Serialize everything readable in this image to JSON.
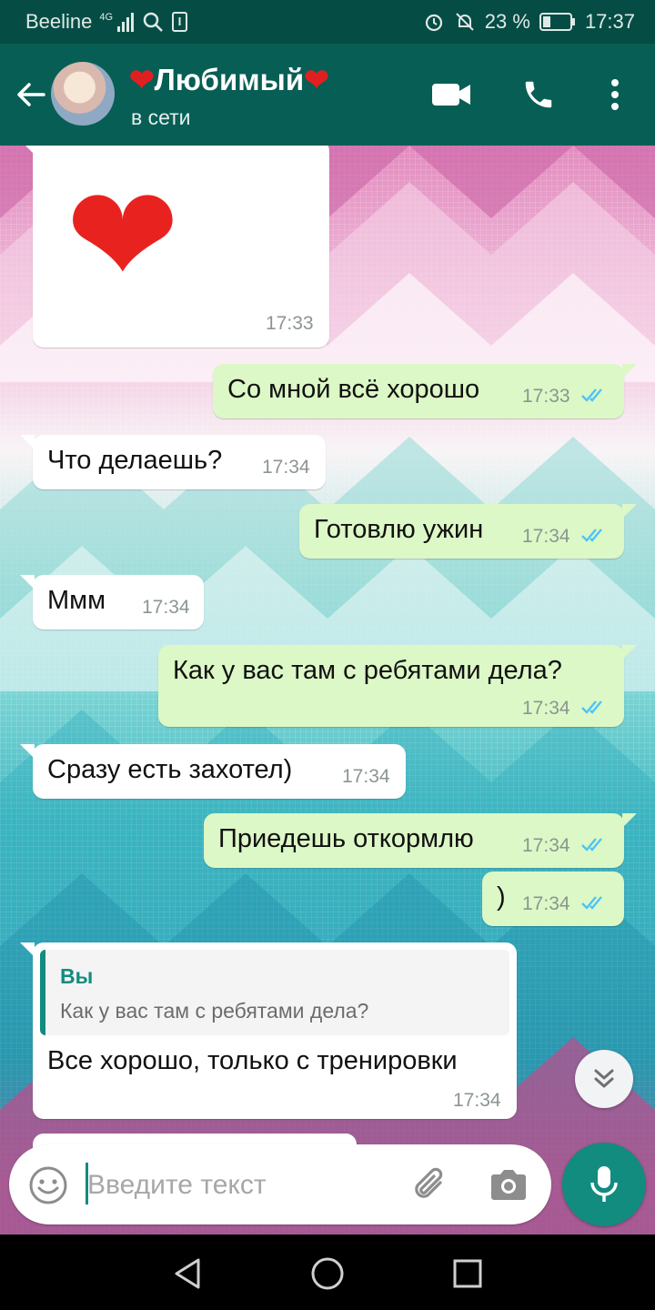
{
  "status_bar": {
    "carrier": "Beeline",
    "network": "4G",
    "battery": "23 %",
    "time": "17:37"
  },
  "header": {
    "contact_name": "Любимый",
    "contact_status": "в сети"
  },
  "messages": [
    {
      "direction": "in",
      "text": "❤",
      "time": "17:33",
      "type": "emoji"
    },
    {
      "direction": "out",
      "text": "Со мной всё хорошо",
      "time": "17:33",
      "status": "read"
    },
    {
      "direction": "in",
      "text": "Что делаешь?",
      "time": "17:34"
    },
    {
      "direction": "out",
      "text": "Готовлю ужин",
      "time": "17:34",
      "status": "read"
    },
    {
      "direction": "in",
      "text": "Ммм",
      "time": "17:34"
    },
    {
      "direction": "out",
      "text": "Как у вас там с ребятами дела?",
      "time": "17:34",
      "status": "read"
    },
    {
      "direction": "in",
      "text": "Сразу есть захотел)",
      "time": "17:34"
    },
    {
      "direction": "out",
      "text": "Приедешь откормлю",
      "time": "17:34",
      "status": "read"
    },
    {
      "direction": "out",
      "text": ")",
      "time": "17:34",
      "status": "read"
    },
    {
      "direction": "in",
      "text": "Все хорошо, только с тренировки",
      "time": "17:34",
      "quote": {
        "author": "Вы",
        "text": "Как у вас там с ребятами дела?"
      }
    }
  ],
  "composer": {
    "placeholder": "Введите текст"
  },
  "colors": {
    "header": "#075e54",
    "status_bar": "#054d44",
    "outgoing_bubble": "#dcf8c6",
    "incoming_bubble": "#ffffff",
    "accent": "#128c7e",
    "read_ticks": "#4fc3f7"
  },
  "icons": {
    "back": "arrow-left-icon",
    "video": "video-camera-icon",
    "call": "phone-icon",
    "menu": "more-vert-icon",
    "emoji": "emoji-icon",
    "attach": "paperclip-icon",
    "camera": "camera-icon",
    "mic": "microphone-icon",
    "scroll": "double-chevron-down-icon"
  }
}
